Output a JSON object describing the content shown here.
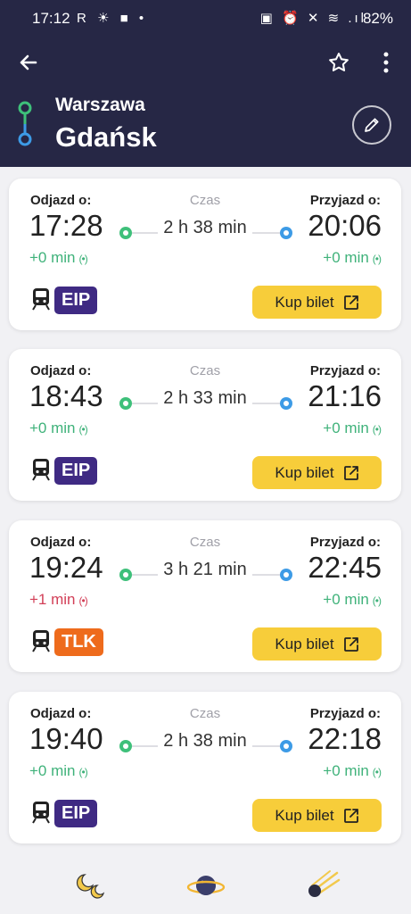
{
  "status_bar": {
    "time": "17:12",
    "left_icons": "R ☀ ■ •",
    "right_icons": "▣ ⏰ ✕ ≋ .ıl",
    "battery": "82%"
  },
  "header": {
    "from_city": "Warszawa",
    "to_city": "Gdańsk"
  },
  "labels": {
    "departure": "Odjazd o:",
    "duration": "Czas",
    "arrival": "Przyjazd o:",
    "buy": "Kup bilet"
  },
  "colors": {
    "header_bg": "#262745",
    "on_time": "#3fb27a",
    "late": "#d23f57",
    "buy_button": "#f7cd3a",
    "eip_badge": "#3f2a83",
    "tlk_badge": "#ee6b1c"
  },
  "trains": [
    {
      "dep": "17:28",
      "arr": "20:06",
      "duration": "2 h 38 min",
      "dep_delay": "+0 min",
      "arr_delay": "+0 min",
      "dep_late": false,
      "type": "EIP"
    },
    {
      "dep": "18:43",
      "arr": "21:16",
      "duration": "2 h 33 min",
      "dep_delay": "+0 min",
      "arr_delay": "+0 min",
      "dep_late": false,
      "type": "EIP"
    },
    {
      "dep": "19:24",
      "arr": "22:45",
      "duration": "3 h 21 min",
      "dep_delay": "+1 min",
      "arr_delay": "+0 min",
      "dep_late": true,
      "type": "TLK"
    },
    {
      "dep": "19:40",
      "arr": "22:18",
      "duration": "2 h 38 min",
      "dep_delay": "+0 min",
      "arr_delay": "+0 min",
      "dep_late": false,
      "type": "EIP"
    }
  ],
  "bottom_nav": [
    "moon-icon",
    "planet-icon",
    "comet-icon"
  ]
}
